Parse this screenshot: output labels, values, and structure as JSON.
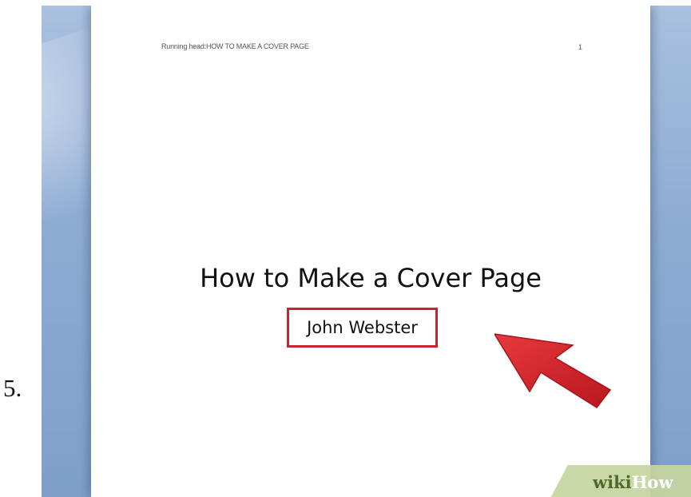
{
  "step": {
    "number": "5."
  },
  "document": {
    "running_head": "Running head:HOW TO MAKE A COVER PAGE",
    "page_number": "1",
    "title": "How to Make a Cover Page",
    "author": "John Webster"
  },
  "annotation": {
    "highlight_color": "#c4262e",
    "arrow_color": "#d8282e",
    "arrow_icon": "red-arrow-pointing-up-left"
  },
  "watermark": {
    "part1": "wiki",
    "part2": "How"
  },
  "colors": {
    "app_background": "#8eabd3",
    "page": "#ffffff"
  }
}
